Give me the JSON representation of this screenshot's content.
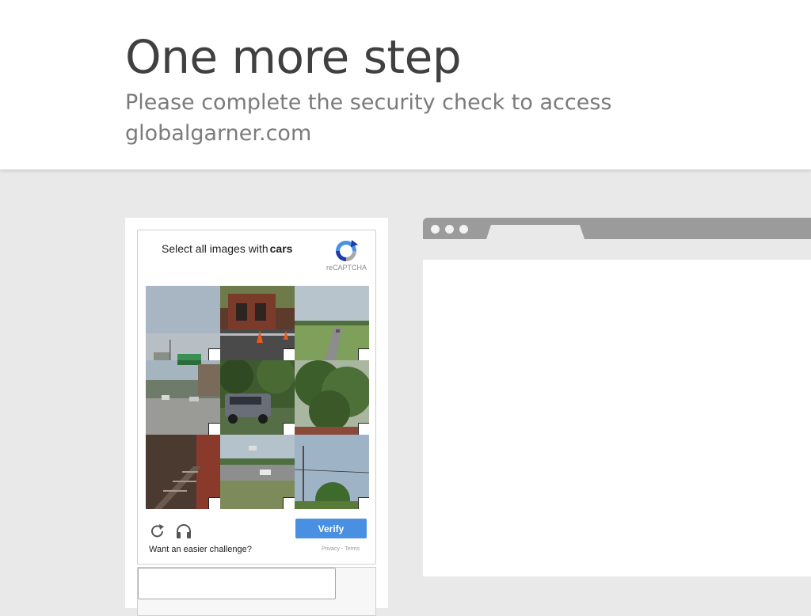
{
  "header": {
    "title": "One more step",
    "subtitle": "Please complete the security check to access globalgarner.com"
  },
  "captcha": {
    "prompt_prefix": "Select all images with",
    "prompt_target": "cars",
    "brand": "reCAPTCHA",
    "verify_label": "Verify",
    "easier_link": "Want an easier challenge?",
    "privacy_link": "Privacy",
    "separator": "-",
    "terms_link": "Terms",
    "answer_value": ""
  },
  "icons": {
    "reload": "reload-icon",
    "audio": "headphones-icon",
    "logo": "recaptcha-logo-icon"
  },
  "colors": {
    "verify_button": "#4a90e2",
    "page_background": "#e9e9e9",
    "browser_bar": "#9b9b9b"
  }
}
